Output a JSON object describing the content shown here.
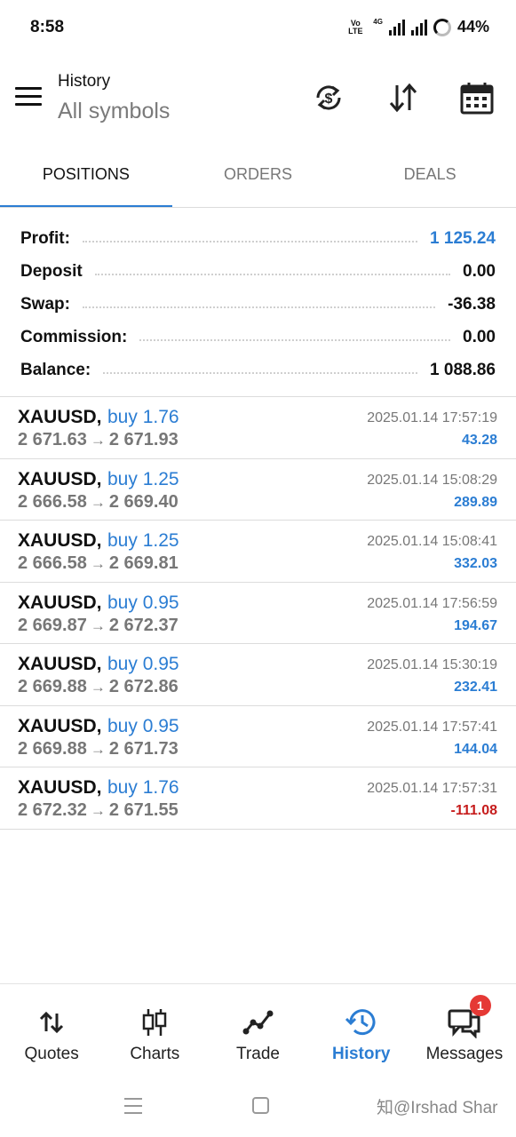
{
  "status_bar": {
    "time": "8:58",
    "volte_top": "Vo",
    "volte_bottom": "LTE",
    "network": "4G",
    "battery": "44%"
  },
  "header": {
    "title": "History",
    "subtitle": "All symbols",
    "icons": [
      "currency-sync-icon",
      "sort-icon",
      "calendar-icon"
    ]
  },
  "tabs": [
    {
      "label": "POSITIONS",
      "active": true
    },
    {
      "label": "ORDERS",
      "active": false
    },
    {
      "label": "DEALS",
      "active": false
    }
  ],
  "summary": [
    {
      "label": "Profit:",
      "value": "1 125.24"
    },
    {
      "label": "Deposit",
      "value": "0.00"
    },
    {
      "label": "Swap:",
      "value": "-36.38"
    },
    {
      "label": "Commission:",
      "value": "0.00"
    },
    {
      "label": "Balance:",
      "value": "1 088.86"
    }
  ],
  "trades": [
    {
      "symbol": "XAUUSD,",
      "side": "buy 1.76",
      "open": "2 671.63",
      "arrow": "→",
      "close": "2 671.93",
      "time": "2025.01.14 17:57:19",
      "profit": "43.28"
    },
    {
      "symbol": "XAUUSD,",
      "side": "buy 1.25",
      "open": "2 666.58",
      "arrow": "→",
      "close": "2 669.40",
      "time": "2025.01.14 15:08:29",
      "profit": "289.89"
    },
    {
      "symbol": "XAUUSD,",
      "side": "buy 1.25",
      "open": "2 666.58",
      "arrow": "→",
      "close": "2 669.81",
      "time": "2025.01.14 15:08:41",
      "profit": "332.03"
    },
    {
      "symbol": "XAUUSD,",
      "side": "buy 0.95",
      "open": "2 669.87",
      "arrow": "→",
      "close": "2 672.37",
      "time": "2025.01.14 17:56:59",
      "profit": "194.67"
    },
    {
      "symbol": "XAUUSD,",
      "side": "buy 0.95",
      "open": "2 669.88",
      "arrow": "→",
      "close": "2 672.86",
      "time": "2025.01.14 15:30:19",
      "profit": "232.41"
    },
    {
      "symbol": "XAUUSD,",
      "side": "buy 0.95",
      "open": "2 669.88",
      "arrow": "→",
      "close": "2 671.73",
      "time": "2025.01.14 17:57:41",
      "profit": "144.04"
    },
    {
      "symbol": "XAUUSD,",
      "side": "buy 1.76",
      "open": "2 672.32",
      "arrow": "→",
      "close": "2 671.55",
      "time": "2025.01.14 17:57:31",
      "profit": "-111.08"
    }
  ],
  "bottom_nav": [
    {
      "label": "Quotes",
      "icon": "quotes-arrows-icon"
    },
    {
      "label": "Charts",
      "icon": "candlestick-icon"
    },
    {
      "label": "Trade",
      "icon": "trade-line-icon"
    },
    {
      "label": "History",
      "icon": "history-clock-icon",
      "active": true
    },
    {
      "label": "Messages",
      "icon": "chat-bubbles-icon",
      "badge": "1"
    }
  ],
  "watermark": "知@Irshad Shar",
  "colors": {
    "accent": "#2b7dd3",
    "negative": "#c61c1c",
    "badge": "#e53935"
  }
}
